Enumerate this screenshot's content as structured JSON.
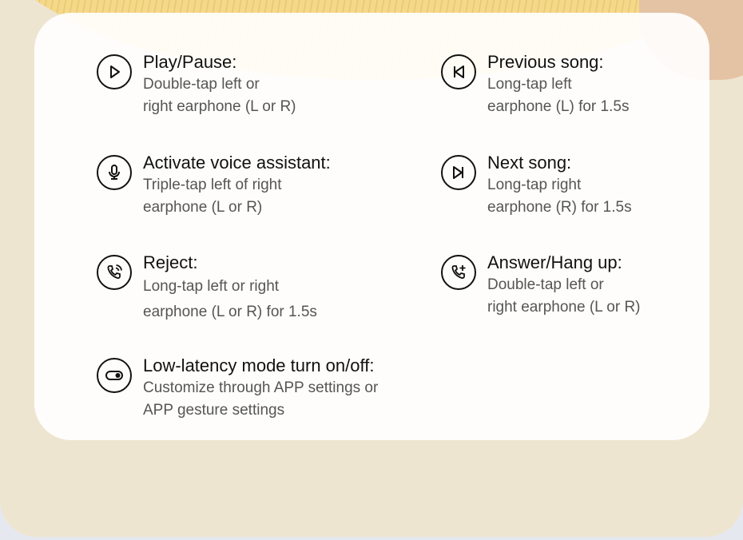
{
  "items": [
    {
      "title": "Play/Pause:",
      "desc": "Double-tap left or\nright earphone (L or R)",
      "icon": "play-icon"
    },
    {
      "title": "Previous song:",
      "desc": "Long-tap left\nearphone (L) for 1.5s",
      "icon": "previous-track-icon"
    },
    {
      "title": "Activate voice assistant:",
      "desc": "Triple-tap left of right\nearphone (L or R)",
      "icon": "microphone-icon"
    },
    {
      "title": "Next song:",
      "desc": "Long-tap right\nearphone (R) for 1.5s",
      "icon": "next-track-icon"
    },
    {
      "title": "Reject:",
      "desc": "Long-tap left or right\nearphone (L or R) for 1.5s",
      "icon": "phone-ringing-icon"
    },
    {
      "title": "Answer/Hang up:",
      "desc": "Double-tap left or\nright earphone (L or R)",
      "icon": "phone-add-icon"
    },
    {
      "title": "Low-latency mode turn on/off:",
      "desc": "Customize through APP settings or\nAPP gesture settings",
      "icon": "toggle-icon"
    }
  ]
}
